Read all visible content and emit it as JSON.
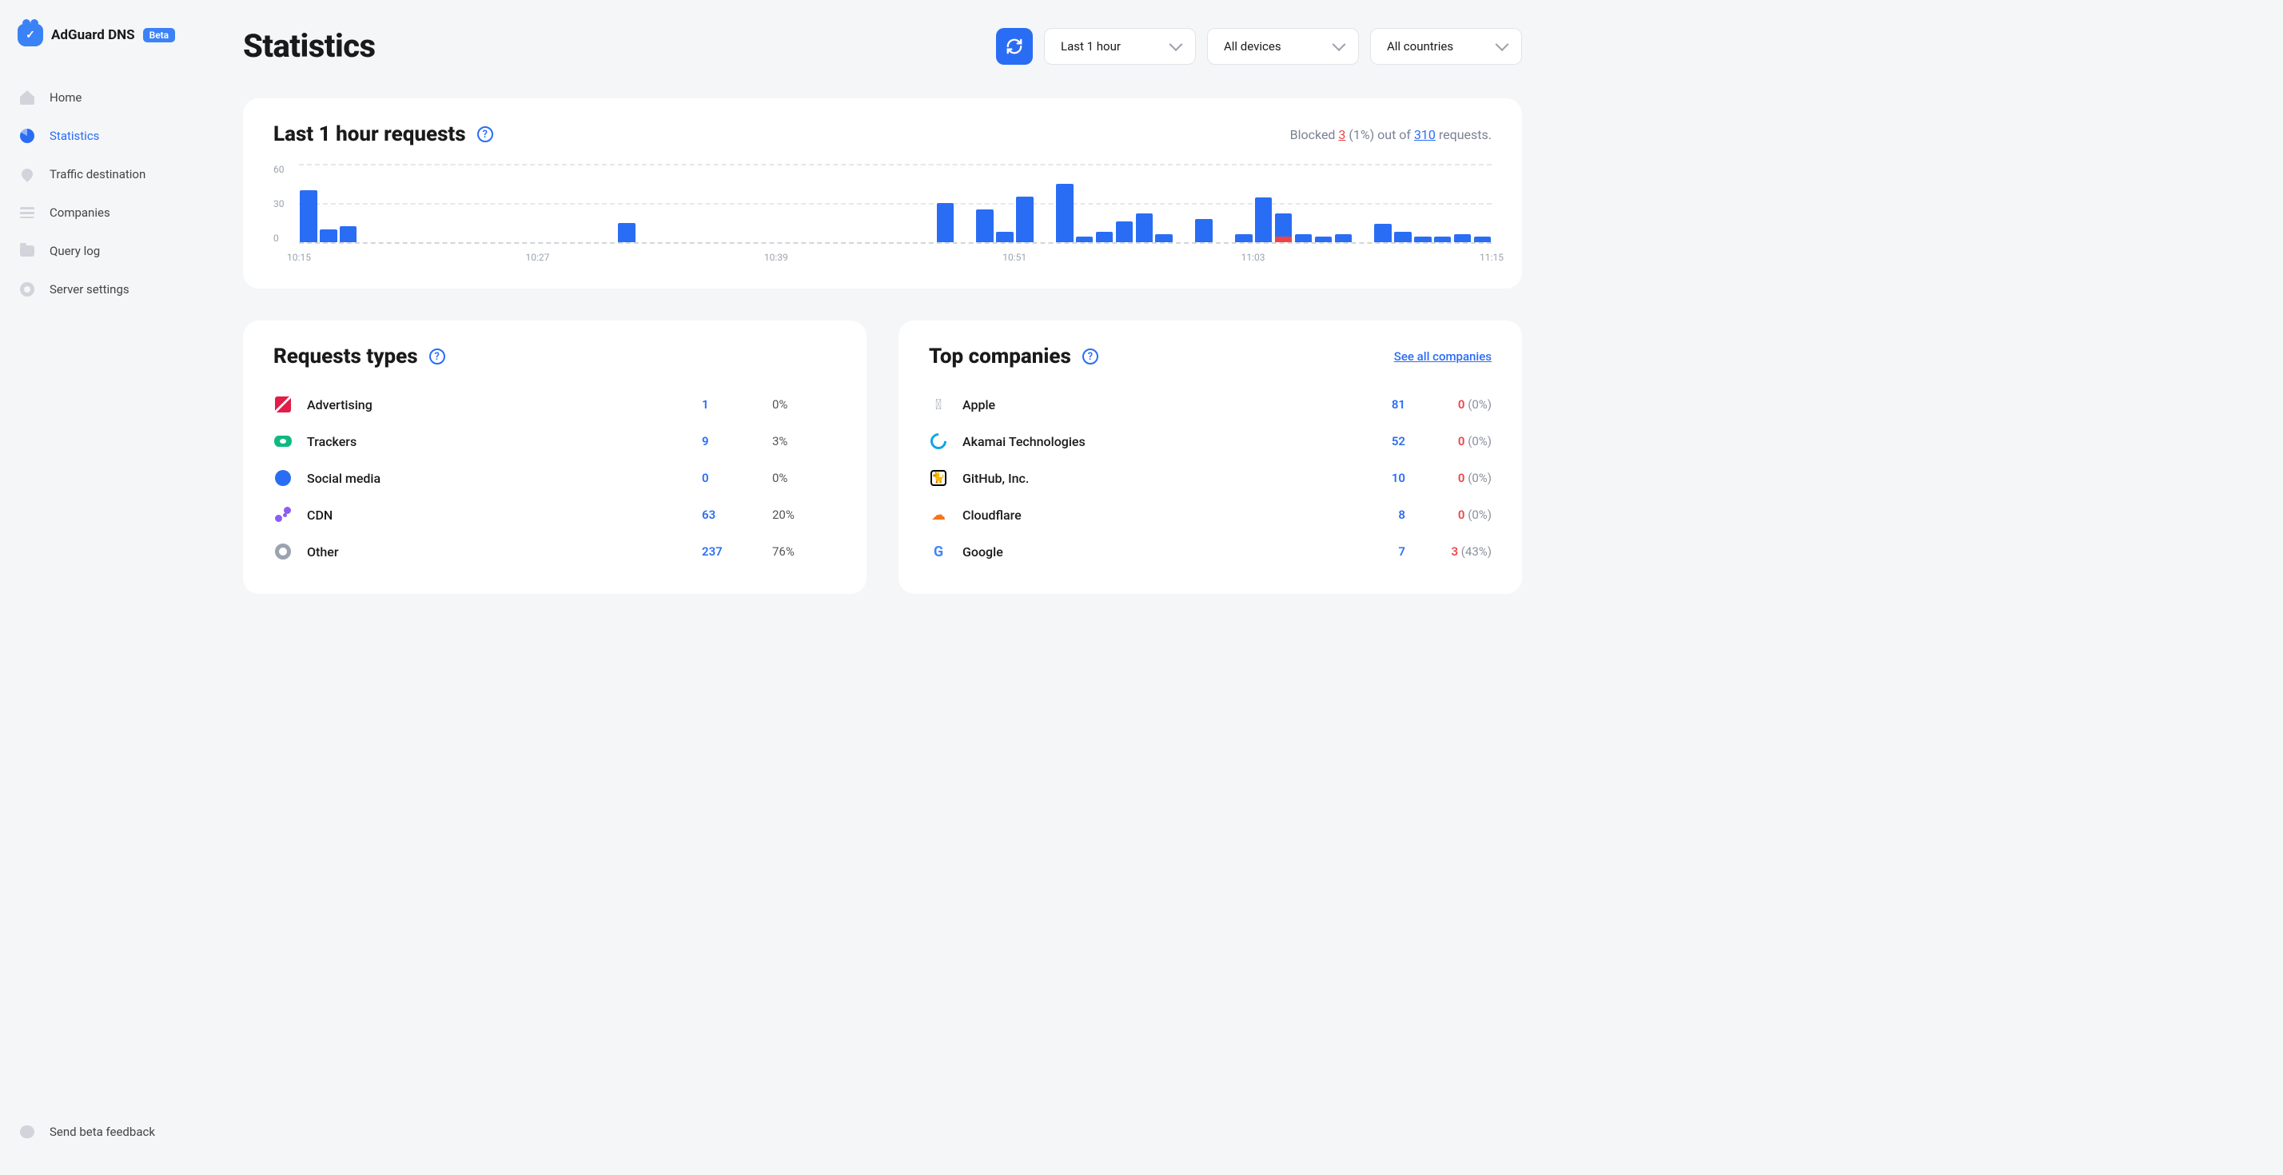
{
  "brand": {
    "name": "AdGuard DNS",
    "badge": "Beta"
  },
  "sidebar": {
    "items": [
      {
        "label": "Home",
        "icon": "home",
        "active": false
      },
      {
        "label": "Statistics",
        "icon": "pie",
        "active": true
      },
      {
        "label": "Traffic destination",
        "icon": "pin",
        "active": false
      },
      {
        "label": "Companies",
        "icon": "lines",
        "active": false
      },
      {
        "label": "Query log",
        "icon": "folder",
        "active": false
      },
      {
        "label": "Server settings",
        "icon": "gear",
        "active": false
      }
    ],
    "feedback": "Send beta feedback"
  },
  "header": {
    "title": "Statistics",
    "filters": {
      "time": "Last 1 hour",
      "devices": "All devices",
      "countries": "All countries"
    }
  },
  "requests_panel": {
    "title": "Last 1 hour requests",
    "summary": {
      "prefix": "Blocked ",
      "blocked": "3",
      "pct": " (1%) out of ",
      "total": "310",
      "suffix": " requests."
    }
  },
  "chart_data": {
    "type": "bar",
    "x_ticks": [
      "10:15",
      "10:27",
      "10:39",
      "10:51",
      "11:03",
      "11:15"
    ],
    "y_ticks": [
      0,
      30,
      60
    ],
    "ylim": [
      0,
      60
    ],
    "series": [
      {
        "name": "total",
        "color": "#2a6df5",
        "values": [
          40,
          10,
          12,
          0,
          0,
          0,
          0,
          0,
          0,
          0,
          0,
          0,
          0,
          0,
          0,
          0,
          15,
          0,
          0,
          0,
          0,
          0,
          0,
          0,
          0,
          0,
          0,
          0,
          0,
          0,
          0,
          0,
          30,
          0,
          25,
          8,
          35,
          0,
          45,
          4,
          8,
          16,
          22,
          6,
          0,
          18,
          0,
          6,
          34,
          22,
          6,
          4,
          6,
          0,
          14,
          8,
          4,
          4,
          6,
          4
        ]
      },
      {
        "name": "blocked",
        "color": "#ef4444",
        "values": [
          0,
          0,
          0,
          0,
          0,
          0,
          0,
          0,
          0,
          0,
          0,
          0,
          0,
          0,
          0,
          0,
          0,
          0,
          0,
          0,
          0,
          0,
          0,
          0,
          0,
          0,
          0,
          0,
          0,
          0,
          0,
          0,
          0,
          0,
          0,
          0,
          0,
          0,
          0,
          0,
          0,
          0,
          0,
          0,
          0,
          0,
          0,
          0,
          0,
          4,
          0,
          0,
          0,
          0,
          0,
          0,
          0,
          0,
          0,
          0
        ]
      }
    ]
  },
  "request_types": {
    "title": "Requests types",
    "rows": [
      {
        "icon": "advertising",
        "label": "Advertising",
        "count": "1",
        "pct": "0%"
      },
      {
        "icon": "trackers",
        "label": "Trackers",
        "count": "9",
        "pct": "3%"
      },
      {
        "icon": "social",
        "label": "Social media",
        "count": "0",
        "pct": "0%"
      },
      {
        "icon": "cdn",
        "label": "CDN",
        "count": "63",
        "pct": "20%"
      },
      {
        "icon": "other",
        "label": "Other",
        "count": "237",
        "pct": "76%"
      }
    ]
  },
  "top_companies": {
    "title": "Top companies",
    "link": "See all companies",
    "rows": [
      {
        "icon": "apple",
        "label": "Apple",
        "count": "81",
        "blocked": "0",
        "bpct": "(0%)"
      },
      {
        "icon": "akamai",
        "label": "Akamai Technologies",
        "count": "52",
        "blocked": "0",
        "bpct": "(0%)"
      },
      {
        "icon": "github",
        "label": "GitHub, Inc.",
        "count": "10",
        "blocked": "0",
        "bpct": "(0%)"
      },
      {
        "icon": "cloudflare",
        "label": "Cloudflare",
        "count": "8",
        "blocked": "0",
        "bpct": "(0%)"
      },
      {
        "icon": "google",
        "label": "Google",
        "count": "7",
        "blocked": "3",
        "bpct": "(43%)"
      }
    ]
  }
}
